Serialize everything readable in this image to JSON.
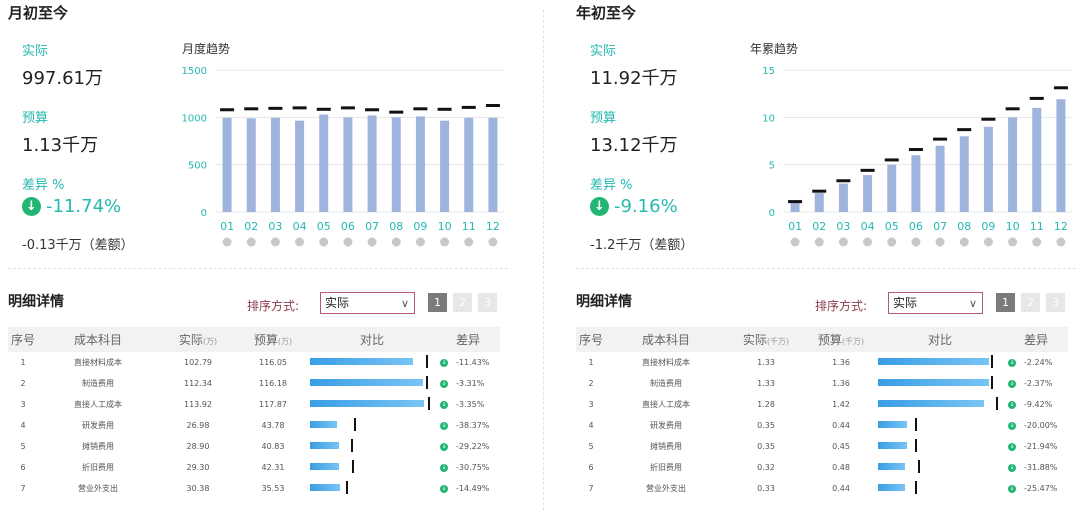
{
  "mtd": {
    "title": "月初至今",
    "actual_label": "实际",
    "actual_value": "997.61万",
    "budget_label": "预算",
    "budget_value": "1.13千万",
    "variance_label": "差异 %",
    "variance_icon": "down-arrow-circle-icon",
    "variance_value": "-11.74%",
    "difference": "-0.13千万（差额）",
    "chart_title": "月度趋势"
  },
  "ytd": {
    "title": "年初至今",
    "actual_label": "实际",
    "actual_value": "11.92千万",
    "budget_label": "预算",
    "budget_value": "13.12千万",
    "variance_label": "差异 %",
    "variance_icon": "down-arrow-circle-icon",
    "variance_value": "-9.16%",
    "difference": "-1.2千万（差额）",
    "chart_title": "年累趋势"
  },
  "chart_data": [
    {
      "type": "bar",
      "title": "月度趋势",
      "categories": [
        "01",
        "02",
        "03",
        "04",
        "05",
        "06",
        "07",
        "08",
        "09",
        "10",
        "11",
        "12"
      ],
      "series": [
        {
          "values": [
            995,
            990,
            995,
            965,
            1030,
            1000,
            1020,
            1000,
            1010,
            965,
            995,
            995
          ]
        },
        {
          "values": [
            1080,
            1090,
            1095,
            1100,
            1085,
            1100,
            1080,
            1055,
            1090,
            1085,
            1105,
            1125
          ]
        }
      ],
      "ylim": [
        0,
        1500
      ],
      "yticks": [
        0,
        500,
        1000,
        1500
      ],
      "grid": true,
      "colors": {
        "actual": "#9fb4dc",
        "budget": "#111111",
        "axis_text": "#24b9b1"
      }
    },
    {
      "type": "bar",
      "title": "年累趋势",
      "categories": [
        "01",
        "02",
        "03",
        "04",
        "05",
        "06",
        "07",
        "08",
        "09",
        "10",
        "11",
        "12"
      ],
      "series": [
        {
          "values": [
            1.0,
            2.0,
            3.0,
            3.9,
            5.0,
            6.0,
            7.0,
            8.0,
            9.0,
            10.0,
            11.0,
            11.92
          ]
        },
        {
          "values": [
            1.1,
            2.2,
            3.3,
            4.4,
            5.5,
            6.6,
            7.7,
            8.7,
            9.8,
            10.9,
            12.0,
            13.12
          ]
        }
      ],
      "ylim": [
        0,
        15
      ],
      "yticks": [
        0,
        5,
        10,
        15
      ],
      "grid": true,
      "colors": {
        "actual": "#9fb4dc",
        "budget": "#111111",
        "axis_text": "#24b9b1"
      }
    }
  ],
  "detail_left": {
    "title": "明细详情",
    "sort_label": "排序方式:",
    "sort_value": "实际",
    "sort_icon": "chevron-down-icon",
    "pages": [
      "1",
      "2",
      "3"
    ],
    "active_page": "1",
    "columns": [
      "序号",
      "成本科目",
      "实际",
      "预算",
      "对比",
      "差异"
    ],
    "unit_actual": "(万)",
    "unit_budget": "(万)",
    "bar_max": 117.87,
    "rows": [
      {
        "no": "1",
        "name": "直接材料成本",
        "actual": "102.79",
        "budget": "116.05",
        "actual_num": 102.79,
        "budget_num": 116.05,
        "diff": "-11.43%"
      },
      {
        "no": "2",
        "name": "制造费用",
        "actual": "112.34",
        "budget": "116.18",
        "actual_num": 112.34,
        "budget_num": 116.18,
        "diff": "-3.31%"
      },
      {
        "no": "3",
        "name": "直接人工成本",
        "actual": "113.92",
        "budget": "117.87",
        "actual_num": 113.92,
        "budget_num": 117.87,
        "diff": "-3.35%"
      },
      {
        "no": "4",
        "name": "研发费用",
        "actual": "26.98",
        "budget": "43.78",
        "actual_num": 26.98,
        "budget_num": 43.78,
        "diff": "-38.37%"
      },
      {
        "no": "5",
        "name": "摊销费用",
        "actual": "28.90",
        "budget": "40.83",
        "actual_num": 28.9,
        "budget_num": 40.83,
        "diff": "-29.22%"
      },
      {
        "no": "6",
        "name": "折旧费用",
        "actual": "29.30",
        "budget": "42.31",
        "actual_num": 29.3,
        "budget_num": 42.31,
        "diff": "-30.75%"
      },
      {
        "no": "7",
        "name": "营业外支出",
        "actual": "30.38",
        "budget": "35.53",
        "actual_num": 30.38,
        "budget_num": 35.53,
        "diff": "-14.49%"
      }
    ]
  },
  "detail_right": {
    "title": "明细详情",
    "sort_label": "排序方式:",
    "sort_value": "实际",
    "sort_icon": "chevron-down-icon",
    "pages": [
      "1",
      "2",
      "3"
    ],
    "active_page": "1",
    "columns": [
      "序号",
      "成本科目",
      "实际",
      "预算",
      "对比",
      "差异"
    ],
    "unit_actual": "(千万)",
    "unit_budget": "(千万)",
    "bar_max": 1.42,
    "rows": [
      {
        "no": "1",
        "name": "直接材料成本",
        "actual": "1.33",
        "budget": "1.36",
        "actual_num": 1.33,
        "budget_num": 1.36,
        "diff": "-2.24%"
      },
      {
        "no": "2",
        "name": "制造费用",
        "actual": "1.33",
        "budget": "1.36",
        "actual_num": 1.33,
        "budget_num": 1.36,
        "diff": "-2.37%"
      },
      {
        "no": "3",
        "name": "直接人工成本",
        "actual": "1.28",
        "budget": "1.42",
        "actual_num": 1.28,
        "budget_num": 1.42,
        "diff": "-9.42%"
      },
      {
        "no": "4",
        "name": "研发费用",
        "actual": "0.35",
        "budget": "0.44",
        "actual_num": 0.35,
        "budget_num": 0.44,
        "diff": "-20.00%"
      },
      {
        "no": "5",
        "name": "摊销费用",
        "actual": "0.35",
        "budget": "0.45",
        "actual_num": 0.35,
        "budget_num": 0.45,
        "diff": "-21.94%"
      },
      {
        "no": "6",
        "name": "折旧费用",
        "actual": "0.32",
        "budget": "0.48",
        "actual_num": 0.32,
        "budget_num": 0.48,
        "diff": "-31.88%"
      },
      {
        "no": "7",
        "name": "营业外支出",
        "actual": "0.33",
        "budget": "0.44",
        "actual_num": 0.33,
        "budget_num": 0.44,
        "diff": "-25.47%"
      }
    ]
  }
}
